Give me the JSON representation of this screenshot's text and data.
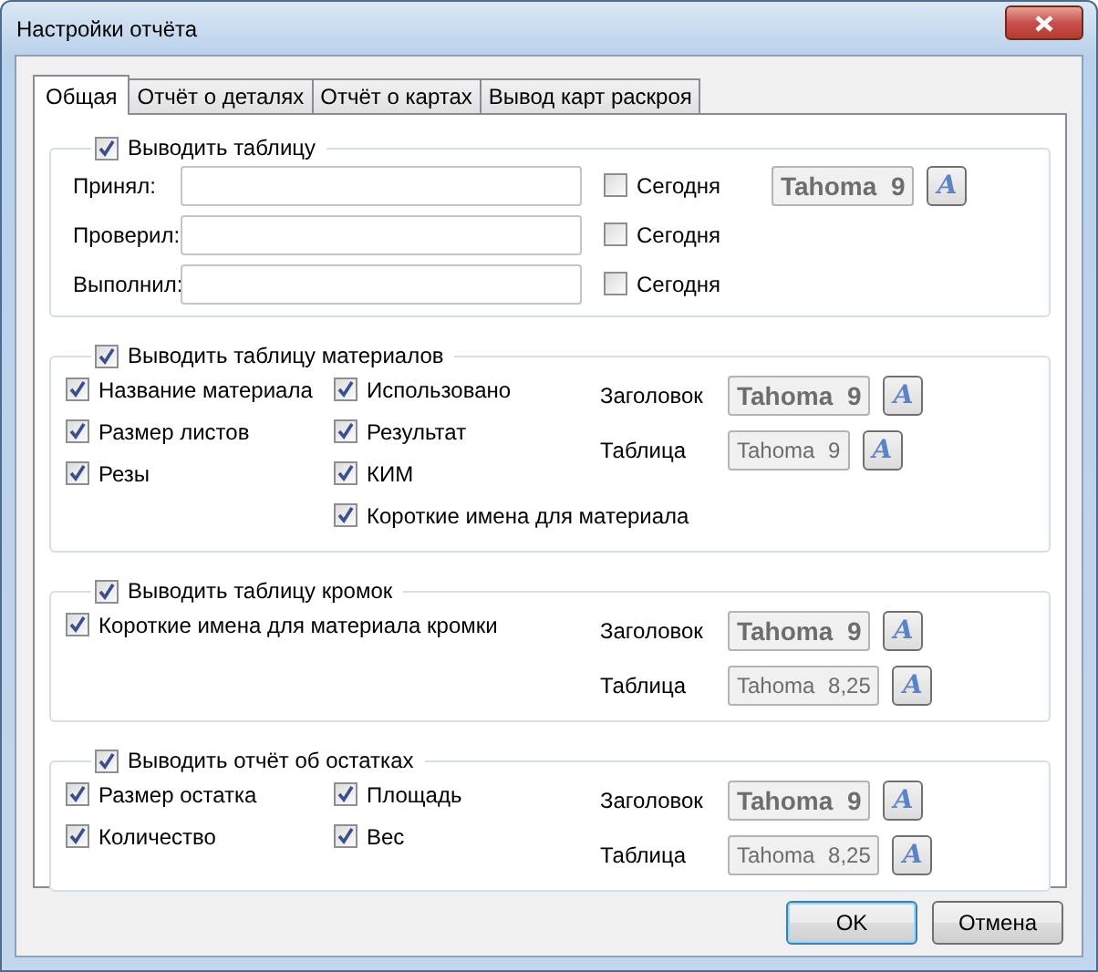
{
  "window": {
    "title": "Настройки отчёта"
  },
  "tabs": [
    {
      "label": "Общая",
      "selected": true
    },
    {
      "label": "Отчёт о деталях",
      "selected": false
    },
    {
      "label": "Отчёт о картах",
      "selected": false
    },
    {
      "label": "Вывод карт раскроя",
      "selected": false
    }
  ],
  "groups": [
    {
      "kind": "signatures",
      "header": {
        "label": "Выводить таблицу",
        "checked": true
      },
      "fields": [
        {
          "label": "Принял:",
          "today": {
            "label": "Сегодня",
            "checked": false
          }
        },
        {
          "label": "Проверил:",
          "today": {
            "label": "Сегодня",
            "checked": false
          }
        },
        {
          "label": "Выполнил:",
          "today": {
            "label": "Сегодня",
            "checked": false
          }
        }
      ],
      "fonts": [
        {
          "value": "Tahoma 9",
          "bold": true,
          "button": "A"
        }
      ]
    },
    {
      "kind": "options",
      "header": {
        "label": "Выводить таблицу материалов",
        "checked": true
      },
      "columns": [
        [
          {
            "label": "Название материала",
            "checked": true
          },
          {
            "label": "Размер листов",
            "checked": true
          },
          {
            "label": "Резы",
            "checked": true
          }
        ],
        [
          {
            "label": "Использовано",
            "checked": true
          },
          {
            "label": "Результат",
            "checked": true
          },
          {
            "label": "КИМ",
            "checked": true
          },
          {
            "label": "Короткие имена для материала",
            "checked": true
          }
        ]
      ],
      "fonts": [
        {
          "label": "Заголовок",
          "value": "Tahoma 9",
          "bold": true,
          "button": "A"
        },
        {
          "label": "Таблица",
          "value": "Tahoma 9",
          "bold": false,
          "button": "A"
        }
      ]
    },
    {
      "kind": "options",
      "header": {
        "label": "Выводить таблицу кромок",
        "checked": true
      },
      "columns": [
        [
          {
            "label": "Короткие имена для материала кромки",
            "checked": true
          }
        ]
      ],
      "fonts": [
        {
          "label": "Заголовок",
          "value": "Tahoma 9",
          "bold": true,
          "button": "A"
        },
        {
          "label": "Таблица",
          "value": "Tahoma 8,25",
          "bold": false,
          "button": "A"
        }
      ]
    },
    {
      "kind": "options",
      "header": {
        "label": "Выводить отчёт об остатках",
        "checked": true
      },
      "columns": [
        [
          {
            "label": "Размер остатка",
            "checked": true
          },
          {
            "label": "Количество",
            "checked": true
          }
        ],
        [
          {
            "label": "Площадь",
            "checked": true
          },
          {
            "label": "Вес",
            "checked": true
          }
        ]
      ],
      "fonts": [
        {
          "label": "Заголовок",
          "value": "Tahoma 9",
          "bold": true,
          "button": "A"
        },
        {
          "label": "Таблица",
          "value": "Tahoma 8,25",
          "bold": false,
          "button": "A"
        }
      ]
    }
  ],
  "buttons": [
    {
      "label": "OK",
      "default": true
    },
    {
      "label": "Отмена",
      "default": false
    }
  ]
}
